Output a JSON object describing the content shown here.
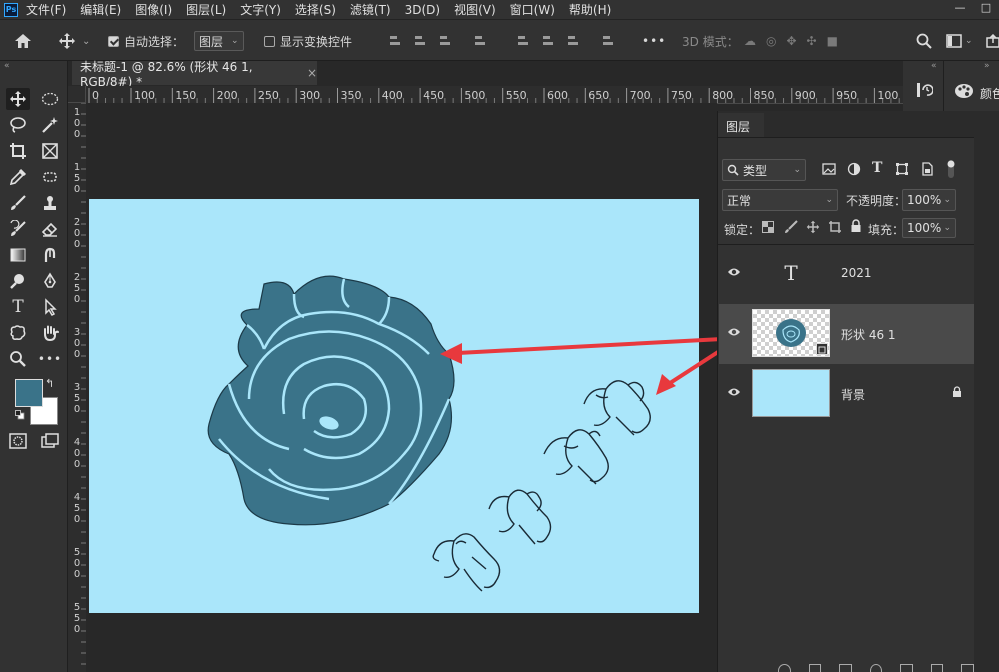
{
  "menu": {
    "logo": "Ps",
    "items": [
      "文件(F)",
      "编辑(E)",
      "图像(I)",
      "图层(L)",
      "文字(Y)",
      "选择(S)",
      "滤镜(T)",
      "3D(D)",
      "视图(V)",
      "窗口(W)",
      "帮助(H)"
    ],
    "win_min": "—",
    "win_max": "□"
  },
  "options": {
    "auto_select_label": "自动选择：",
    "auto_select_value": "图层",
    "show_transform_label": "显示变换控件",
    "more": "•••",
    "mode_3d_label": "3D 模式："
  },
  "document": {
    "tab_title": "未标题-1 @ 82.6% (形状 46 1, RGB/8#) *",
    "close": "×"
  },
  "ruler": {
    "h_labels": [
      "0",
      "100",
      "150",
      "200",
      "250",
      "300",
      "350",
      "400",
      "450",
      "500",
      "550",
      "600",
      "650",
      "700",
      "750",
      "800",
      "850",
      "900",
      "950",
      "100"
    ],
    "v_labels": [
      "1",
      "0",
      "0",
      "1",
      "5",
      "0",
      "2",
      "0",
      "0",
      "2",
      "5",
      "0",
      "3",
      "0",
      "0",
      "3",
      "5",
      "0",
      "4",
      "0",
      "0",
      "4",
      "5",
      "0",
      "5",
      "0",
      "0",
      "5",
      "5",
      "0"
    ]
  },
  "colors": {
    "foreground": "#3a7389",
    "background": "#ffffff",
    "canvas_bg": "#aae6fa",
    "rose_fill": "#3a7389",
    "arrow": "#e8393d"
  },
  "layers_panel": {
    "title": "图层",
    "filter_label": "类型",
    "blend_mode": "正常",
    "opacity_label": "不透明度：",
    "opacity_value": "100%",
    "lock_label": "锁定：",
    "fill_label": "填充：",
    "fill_value": "100%",
    "layers": [
      {
        "name": "2021",
        "type": "text",
        "visible": true
      },
      {
        "name": "形状  46 1",
        "type": "shape",
        "visible": true,
        "selected": true
      },
      {
        "name": "背景",
        "type": "background",
        "visible": true,
        "locked": true
      }
    ]
  },
  "side_panel": {
    "color_label": "颜色"
  }
}
